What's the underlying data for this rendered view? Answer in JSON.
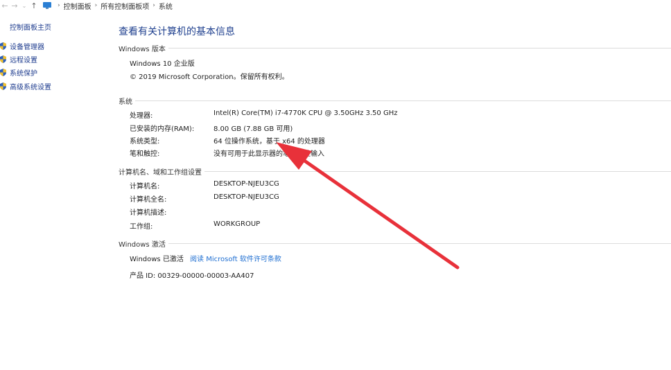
{
  "address_bar": {
    "back_icon": "arrow-left-icon",
    "forward_icon": "arrow-right-icon",
    "recent_icon": "chevron-down-icon",
    "up_icon": "arrow-up-icon",
    "breadcrumb": [
      "控制面板",
      "所有控制面板项",
      "系统"
    ]
  },
  "sidebar": {
    "home": "控制面板主页",
    "links": [
      {
        "label": "设备管理器",
        "icon": "shield-icon"
      },
      {
        "label": "远程设置",
        "icon": "shield-icon"
      },
      {
        "label": "系统保护",
        "icon": "shield-icon"
      },
      {
        "label": "高级系统设置",
        "icon": "shield-icon"
      }
    ]
  },
  "main": {
    "title": "查看有关计算机的基本信息",
    "windows_edition": {
      "header": "Windows 版本",
      "edition": "Windows 10 企业版",
      "copyright": "© 2019 Microsoft Corporation。保留所有权利。"
    },
    "system": {
      "header": "系统",
      "rows": [
        {
          "label": "处理器:",
          "value": "Intel(R) Core(TM) i7-4770K CPU @ 3.50GHz   3.50 GHz"
        },
        {
          "label": "已安装的内存(RAM):",
          "value": "8.00 GB (7.88 GB 可用)"
        },
        {
          "label": "系统类型:",
          "value": "64 位操作系统，基于 x64 的处理器"
        },
        {
          "label": "笔和触控:",
          "value": "没有可用于此显示器的笔或触控输入"
        }
      ]
    },
    "computer_name": {
      "header": "计算机名、域和工作组设置",
      "rows": [
        {
          "label": "计算机名:",
          "value": "DESKTOP-NJEU3CG"
        },
        {
          "label": "计算机全名:",
          "value": "DESKTOP-NJEU3CG"
        },
        {
          "label": "计算机描述:",
          "value": ""
        },
        {
          "label": "工作组:",
          "value": "WORKGROUP"
        }
      ]
    },
    "activation": {
      "header": "Windows 激活",
      "status": "Windows 已激活",
      "license_link": "阅读 Microsoft 软件许可条款",
      "product_id": "产品 ID: 00329-00000-00003-AA407"
    }
  },
  "colors": {
    "title": "#1e3f8e",
    "link": "#1e6ed1",
    "annotation_arrow": "#e8313a"
  }
}
